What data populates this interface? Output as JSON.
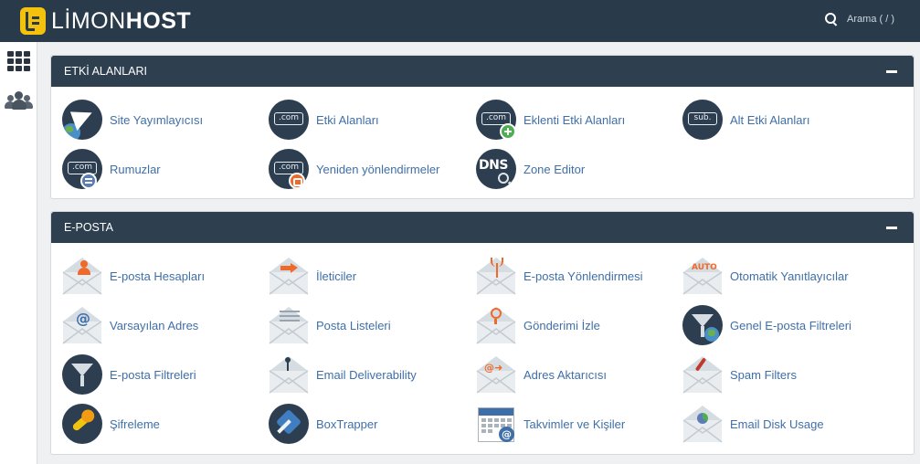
{
  "brand": {
    "part1": "LİMON",
    "part2": "HOST"
  },
  "search": {
    "label": "Arama ( / )"
  },
  "panels": [
    {
      "title": "ETKİ ALANLARI",
      "items": [
        {
          "label": "Site Yayımlayıcısı",
          "icon": "site-publisher-icon"
        },
        {
          "label": "Etki Alanları",
          "icon": "domains-icon",
          "tag": ".com"
        },
        {
          "label": "Eklenti Etki Alanları",
          "icon": "addon-domains-icon",
          "tag": ".com"
        },
        {
          "label": "Alt Etki Alanları",
          "icon": "subdomains-icon",
          "tag": "sub."
        },
        {
          "label": "Rumuzlar",
          "icon": "aliases-icon",
          "tag": ".com"
        },
        {
          "label": "Yeniden yönlendirmeler",
          "icon": "redirects-icon",
          "tag": ".com"
        },
        {
          "label": "Zone Editor",
          "icon": "zone-editor-icon",
          "tag": "DNS"
        }
      ]
    },
    {
      "title": "E-POSTA",
      "items": [
        {
          "label": "E-posta Hesapları",
          "icon": "email-accounts-icon"
        },
        {
          "label": "İleticiler",
          "icon": "forwarders-icon"
        },
        {
          "label": "E-posta Yönlendirmesi",
          "icon": "email-routing-icon"
        },
        {
          "label": "Otomatik Yanıtlayıcılar",
          "icon": "autoresponders-icon",
          "tag": "AUTO"
        },
        {
          "label": "Varsayılan Adres",
          "icon": "default-address-icon",
          "tag": "@"
        },
        {
          "label": "Posta Listeleri",
          "icon": "mailing-lists-icon"
        },
        {
          "label": "Gönderimi İzle",
          "icon": "track-delivery-icon"
        },
        {
          "label": "Genel E-posta Filtreleri",
          "icon": "global-email-filters-icon"
        },
        {
          "label": "E-posta Filtreleri",
          "icon": "email-filters-icon"
        },
        {
          "label": "Email Deliverability",
          "icon": "email-deliverability-icon"
        },
        {
          "label": "Adres Aktarıcısı",
          "icon": "address-importer-icon",
          "tag": "@➜"
        },
        {
          "label": "Spam Filters",
          "icon": "spam-filters-icon"
        },
        {
          "label": "Şifreleme",
          "icon": "encryption-icon"
        },
        {
          "label": "BoxTrapper",
          "icon": "boxtrapper-icon"
        },
        {
          "label": "Takvimler ve Kişiler",
          "icon": "calendars-contacts-icon",
          "tag": "@"
        },
        {
          "label": "Email Disk Usage",
          "icon": "email-disk-usage-icon"
        }
      ]
    }
  ]
}
